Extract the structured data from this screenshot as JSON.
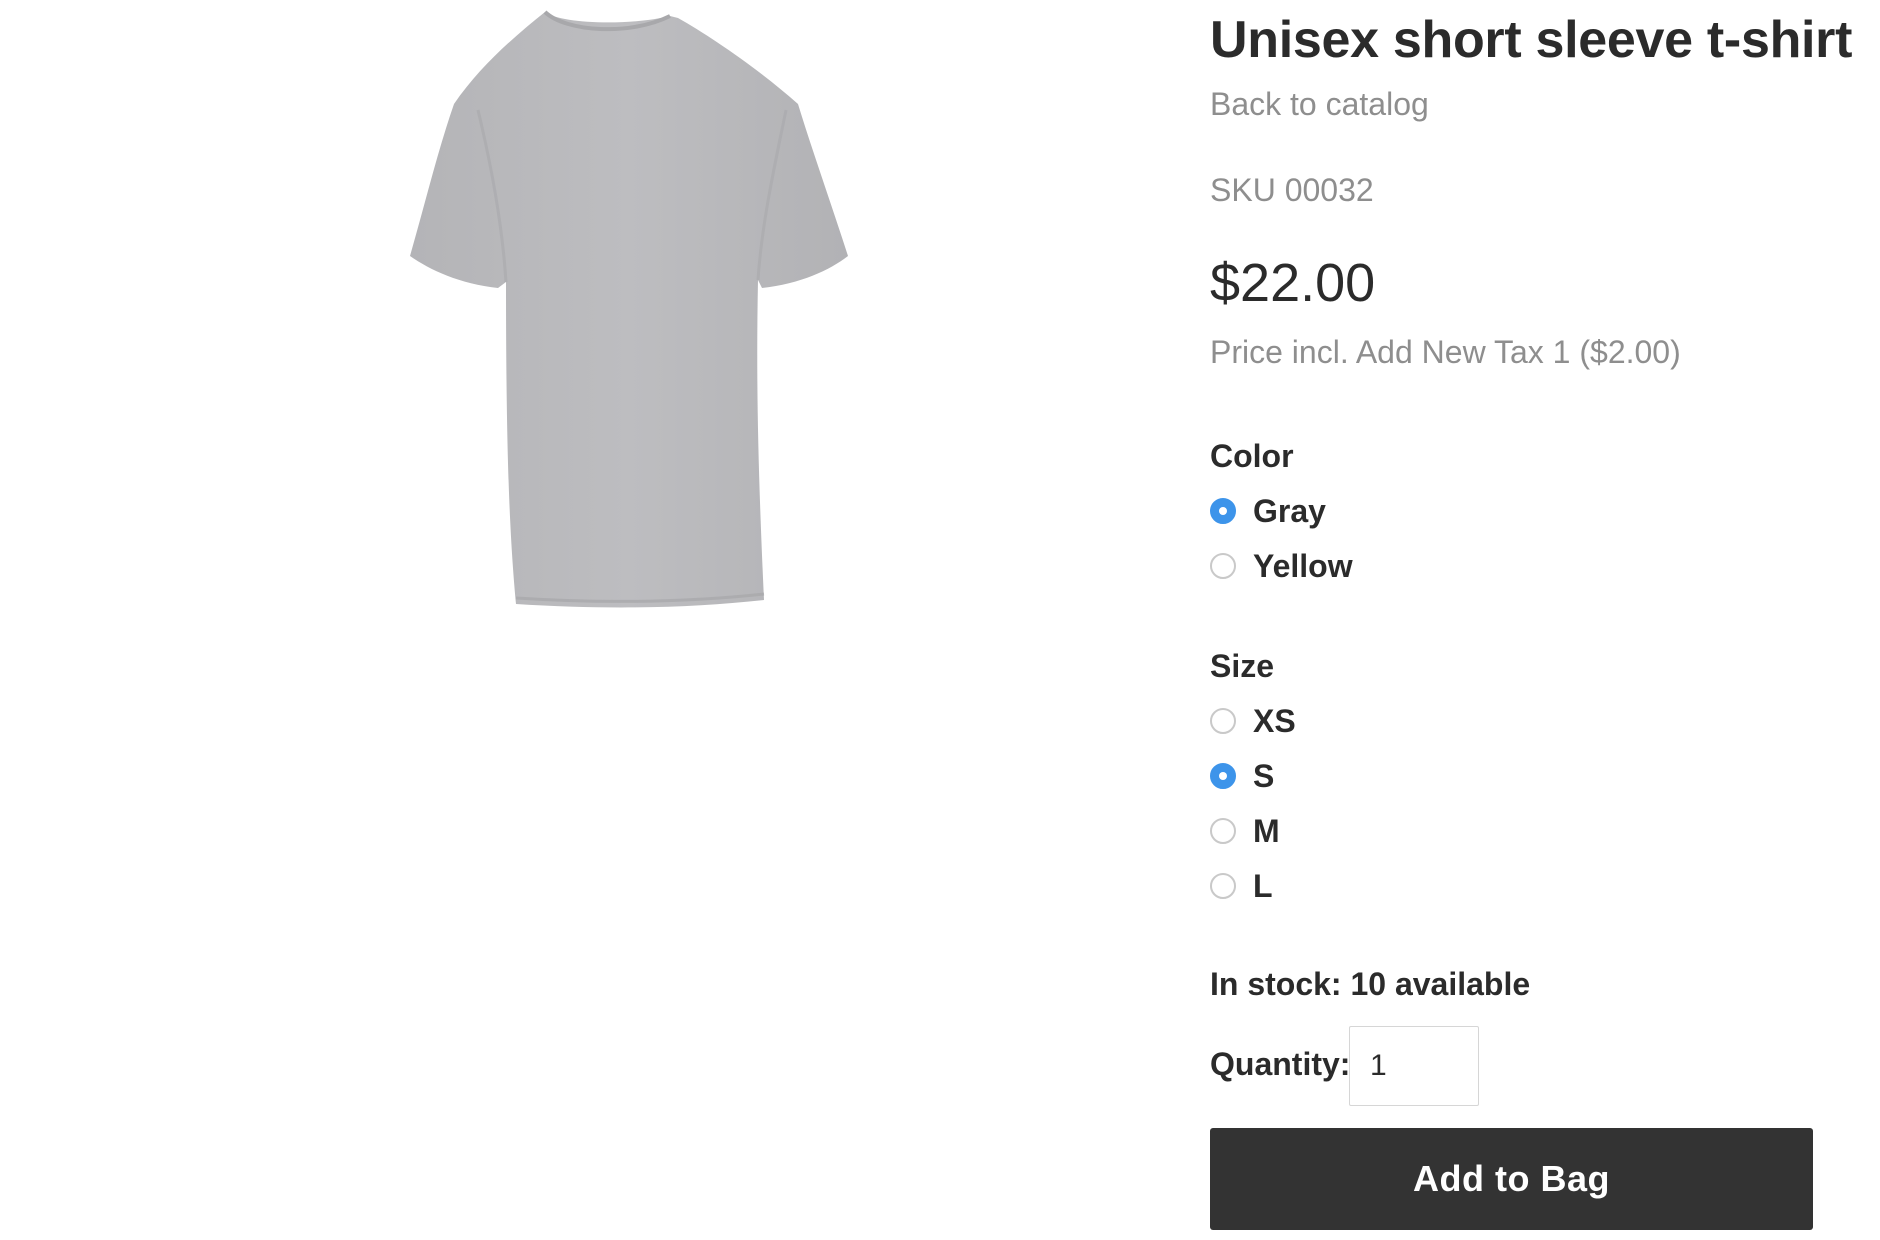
{
  "product": {
    "title": "Unisex short sleeve t-shirt",
    "back_link": "Back to catalog",
    "sku": "SKU 00032",
    "price": "$22.00",
    "tax_note": "Price incl. Add New Tax 1 ($2.00)",
    "image_icon": "gray-tshirt-image"
  },
  "options": {
    "color": {
      "label": "Color",
      "items": [
        {
          "label": "Gray",
          "checked": true
        },
        {
          "label": "Yellow",
          "checked": false
        }
      ]
    },
    "size": {
      "label": "Size",
      "items": [
        {
          "label": "XS",
          "checked": false
        },
        {
          "label": "S",
          "checked": true
        },
        {
          "label": "M",
          "checked": false
        },
        {
          "label": "L",
          "checked": false
        }
      ]
    }
  },
  "stock": {
    "text": "In stock: 10 available"
  },
  "quantity": {
    "label": "Quantity:",
    "value": "1"
  },
  "cart": {
    "add_label": "Add to Bag"
  },
  "colors": {
    "radio_selected": "#3d94ea",
    "button_bg": "#333333",
    "muted_text": "#8e8e8e",
    "shirt_gray": "#b9b9bc"
  }
}
